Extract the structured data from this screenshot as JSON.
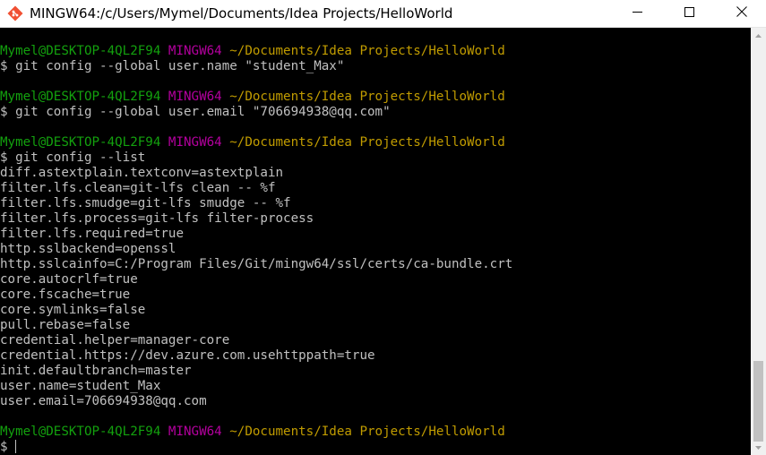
{
  "window": {
    "title": "MINGW64:/c/Users/Mymel/Documents/Idea Projects/HelloWorld",
    "icon": "git-bash-icon"
  },
  "controls": {
    "minimize": "minimize-icon",
    "maximize": "maximize-icon",
    "close": "close-icon"
  },
  "colors": {
    "user_host": "#13a10e",
    "shell": "#b4009e",
    "path": "#c19c00",
    "text": "#c0c0c0",
    "background": "#000000"
  },
  "terminal": {
    "lines": [
      {
        "type": "prompt",
        "user": "Mymel@DESKTOP-4QL2F94",
        "shell": "MINGW64",
        "path": "~/Documents/Idea Projects/HelloWorld"
      },
      {
        "type": "command",
        "text": "$ git config --global user.name \"student_Max\""
      },
      {
        "type": "blank",
        "text": ""
      },
      {
        "type": "prompt",
        "user": "Mymel@DESKTOP-4QL2F94",
        "shell": "MINGW64",
        "path": "~/Documents/Idea Projects/HelloWorld"
      },
      {
        "type": "command",
        "text": "$ git config --global user.email \"706694938@qq.com\""
      },
      {
        "type": "blank",
        "text": ""
      },
      {
        "type": "prompt",
        "user": "Mymel@DESKTOP-4QL2F94",
        "shell": "MINGW64",
        "path": "~/Documents/Idea Projects/HelloWorld"
      },
      {
        "type": "command",
        "text": "$ git config --list"
      },
      {
        "type": "output",
        "text": "diff.astextplain.textconv=astextplain"
      },
      {
        "type": "output",
        "text": "filter.lfs.clean=git-lfs clean -- %f"
      },
      {
        "type": "output",
        "text": "filter.lfs.smudge=git-lfs smudge -- %f"
      },
      {
        "type": "output",
        "text": "filter.lfs.process=git-lfs filter-process"
      },
      {
        "type": "output",
        "text": "filter.lfs.required=true"
      },
      {
        "type": "output",
        "text": "http.sslbackend=openssl"
      },
      {
        "type": "output",
        "text": "http.sslcainfo=C:/Program Files/Git/mingw64/ssl/certs/ca-bundle.crt"
      },
      {
        "type": "output",
        "text": "core.autocrlf=true"
      },
      {
        "type": "output",
        "text": "core.fscache=true"
      },
      {
        "type": "output",
        "text": "core.symlinks=false"
      },
      {
        "type": "output",
        "text": "pull.rebase=false"
      },
      {
        "type": "output",
        "text": "credential.helper=manager-core"
      },
      {
        "type": "output",
        "text": "credential.https://dev.azure.com.usehttppath=true"
      },
      {
        "type": "output",
        "text": "init.defaultbranch=master"
      },
      {
        "type": "output",
        "text": "user.name=student_Max"
      },
      {
        "type": "output",
        "text": "user.email=706694938@qq.com"
      },
      {
        "type": "blank",
        "text": ""
      },
      {
        "type": "prompt",
        "user": "Mymel@DESKTOP-4QL2F94",
        "shell": "MINGW64",
        "path": "~/Documents/Idea Projects/HelloWorld"
      },
      {
        "type": "input",
        "text": "$ "
      }
    ]
  }
}
